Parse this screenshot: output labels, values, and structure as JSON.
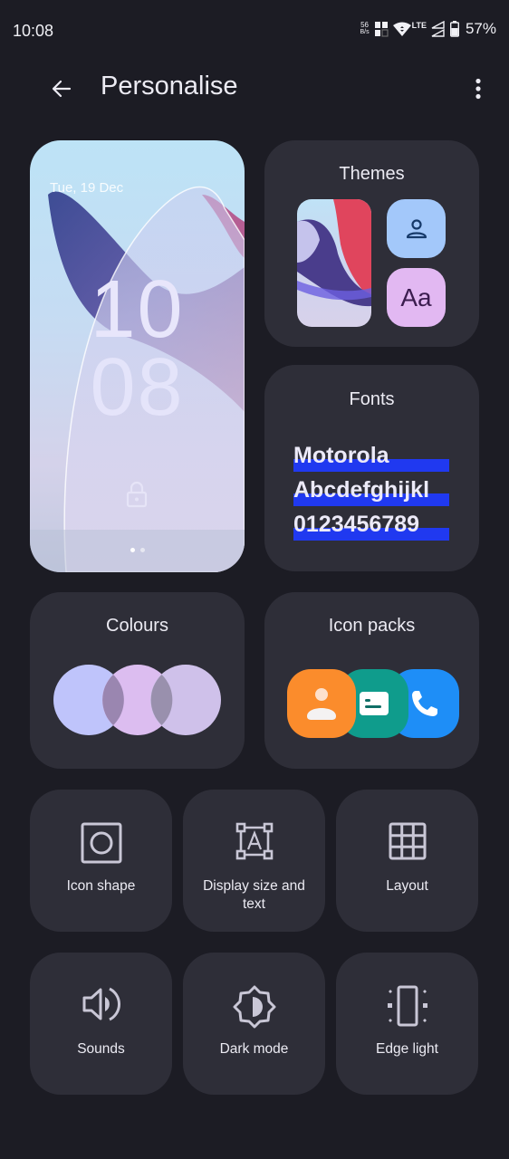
{
  "status_bar": {
    "time": "10:08",
    "net_speed_value": "56",
    "net_speed_unit": "B/s",
    "network_type": "LTE",
    "battery_percent": "57%"
  },
  "app_bar": {
    "title": "Personalise",
    "back_icon": "arrow-back-icon",
    "more_icon": "more-vert-icon"
  },
  "lock_preview": {
    "date": "Tue, 19 Dec",
    "hour": "10",
    "minute": "08",
    "pages": 2,
    "active_page": 1
  },
  "cards": {
    "themes": {
      "title": "Themes",
      "font_sample": "Aa"
    },
    "fonts": {
      "title": "Fonts",
      "samples": [
        "Motorola",
        "Abcdefghijkl",
        "0123456789"
      ]
    },
    "colours": {
      "title": "Colours",
      "swatches": [
        "#bfc4fb",
        "#dcbdf0",
        "#cfc1ea"
      ]
    },
    "icon_packs": {
      "title": "Icon packs",
      "tiles": [
        {
          "name": "contacts",
          "color": "#fb8c2c"
        },
        {
          "name": "messages",
          "color": "#0f9c8c"
        },
        {
          "name": "phone",
          "color": "#1e8ef7"
        }
      ]
    }
  },
  "shortcuts": [
    {
      "label": "Icon shape",
      "icon": "icon-shape-icon"
    },
    {
      "label": "Display size and text",
      "icon": "display-size-icon"
    },
    {
      "label": "Layout",
      "icon": "grid-layout-icon"
    },
    {
      "label": "Sounds",
      "icon": "volume-icon"
    },
    {
      "label": "Dark mode",
      "icon": "dark-mode-icon"
    },
    {
      "label": "Edge light",
      "icon": "edge-light-icon"
    }
  ]
}
